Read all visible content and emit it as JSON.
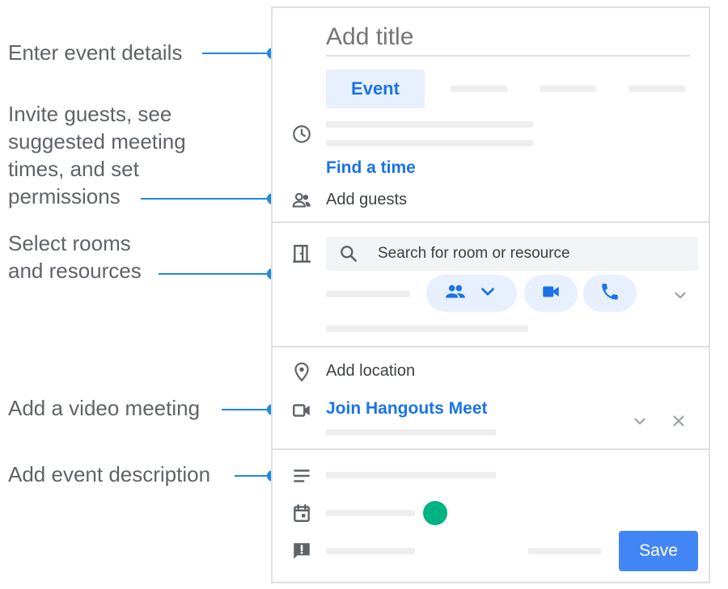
{
  "callouts": [
    {
      "text": "Enter event details"
    },
    {
      "text": "Invite guests, see\nsuggested meeting\ntimes, and set\npermissions"
    },
    {
      "text": "Select rooms\nand resources"
    },
    {
      "text": "Add a video meeting"
    },
    {
      "text": "Add event description"
    }
  ],
  "form": {
    "title_placeholder": "Add title",
    "tab_event": "Event",
    "find_time": "Find a time",
    "add_guests": "Add guests",
    "room_search_placeholder": "Search for room or resource",
    "add_location": "Add location",
    "join_meet": "Join Hangouts Meet",
    "save": "Save"
  },
  "colors": {
    "accent": "#1a73e8",
    "leader": "#1e88e5",
    "save_button": "#4285f4",
    "event_color": "#00b383",
    "tab_bg": "#e8f0fe"
  },
  "icons": [
    "clock-icon",
    "people-icon",
    "door-icon",
    "search-icon",
    "group-icon",
    "chevron-down-icon",
    "video-icon",
    "phone-icon",
    "location-icon",
    "close-icon",
    "description-icon",
    "calendar-icon",
    "feedback-icon"
  ]
}
